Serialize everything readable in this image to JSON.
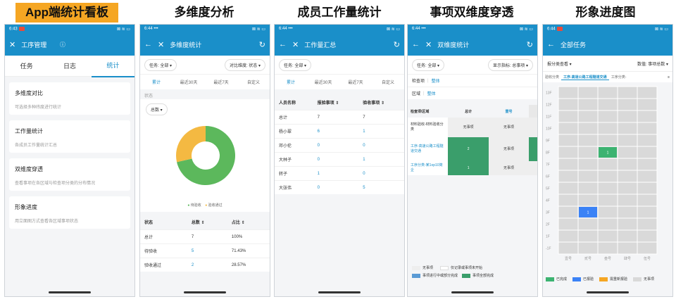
{
  "captions": [
    "App端统计看板",
    "多维度分析",
    "成员工作量统计",
    "事项双维度穿透",
    "形象进度图"
  ],
  "status": {
    "time": "6:43",
    "time2": "6:44",
    "dots": "•••",
    "right": "⊠ ≋ ▭"
  },
  "phone1": {
    "title": "工序管理",
    "tabs": [
      "任务",
      "日志",
      "统计"
    ],
    "cards": [
      {
        "title": "多维度对比",
        "desc": "可选择多种纬度进行统计"
      },
      {
        "title": "工作量统计",
        "desc": "各成员工作量统计汇总"
      },
      {
        "title": "双维度穿透",
        "desc": "查看事项在各区域与检查项分类的分布情况"
      },
      {
        "title": "形象进度",
        "desc": "用立面图方式查看各区域事项状态"
      }
    ]
  },
  "phone2": {
    "title": "多维度统计",
    "filter_left": "任务: 全部",
    "filter_right": "对比维度: 状态",
    "time_tabs": [
      "累计",
      "最近30天",
      "最近7天",
      "自定义"
    ],
    "section": "状态",
    "metric": "总数",
    "legend": [
      "待验收",
      "验收通过"
    ],
    "table_headers": [
      "状态",
      "总数",
      "占比"
    ],
    "rows": [
      {
        "name": "总计",
        "count": "7",
        "pct": "100%"
      },
      {
        "name": "待验收",
        "count": "5",
        "pct": "71.43%"
      },
      {
        "name": "验收通过",
        "count": "2",
        "pct": "28.57%"
      }
    ]
  },
  "chart_data": {
    "type": "pie",
    "categories": [
      "待验收",
      "验收通过"
    ],
    "values": [
      5,
      2
    ],
    "colors": [
      "#5cb85c",
      "#f4b942"
    ]
  },
  "phone3": {
    "title": "工作量汇总",
    "filter": "任务: 全部",
    "time_tabs": [
      "累计",
      "最近30天",
      "最近7天",
      "自定义"
    ],
    "headers": [
      "人员名称",
      "报验事项",
      "验收事项"
    ],
    "rows": [
      {
        "name": "总计",
        "a": "7",
        "b": "7"
      },
      {
        "name": "杨小翠",
        "a": "6",
        "b": "1"
      },
      {
        "name": "邓小伦",
        "a": "0",
        "b": "0"
      },
      {
        "name": "大林子",
        "a": "0",
        "b": "1"
      },
      {
        "name": "转子",
        "a": "1",
        "b": "0"
      },
      {
        "name": "大张伟",
        "a": "0",
        "b": "5"
      }
    ]
  },
  "phone4": {
    "title": "双维度统计",
    "filter_left": "任务: 全部",
    "filter_right": "显示指标: 总事项",
    "row1_label": "检查项",
    "row1_value": "整体",
    "row2_label": "区域",
    "row2_value": "整体",
    "matrix_header": [
      "检查项\\区域",
      "总计",
      "壹号"
    ],
    "matrix_rows": [
      {
        "name": "材料验收-材料验收分类",
        "total": "无事项",
        "c1": "无事项"
      },
      {
        "name": "工序-高速公路工程隧道交通",
        "total": "2",
        "c1": "无事项"
      },
      {
        "name": "工序分类-某1op10简企",
        "total": "1",
        "c1": "无事项"
      }
    ],
    "legend": [
      "无事项",
      "仅记录或事项未开始",
      "事项进行中或部分完成",
      "事项全部完成"
    ]
  },
  "phone5": {
    "title": "全部任务",
    "filter_left": "报分类查看",
    "filter_right": "数值: 事项总数",
    "tabs": [
      "验收分类",
      "工序-高速公路工程隧道交通",
      "工序分类-"
    ],
    "floors": [
      "13F",
      "12F",
      "11F",
      "10F",
      "9F",
      "8F",
      "7F",
      "6F",
      "5F",
      "4F",
      "3F",
      "2F",
      "1F",
      "-1F"
    ],
    "columns": [
      "壹号",
      "贰号",
      "叁号",
      "肆号",
      "伍号"
    ],
    "cells": [
      {
        "floor": "8F",
        "col": "叁号",
        "value": "1",
        "color": "#3cb371"
      },
      {
        "floor": "3F",
        "col": "贰号",
        "value": "1",
        "color": "#3b82f6"
      }
    ],
    "legend": [
      {
        "label": "已完成",
        "color": "#3cb371"
      },
      {
        "label": "已报验",
        "color": "#3b82f6"
      },
      {
        "label": "需重新报验",
        "color": "#f5a623"
      },
      {
        "label": "无事项",
        "color": "#d9d9d9"
      }
    ]
  }
}
